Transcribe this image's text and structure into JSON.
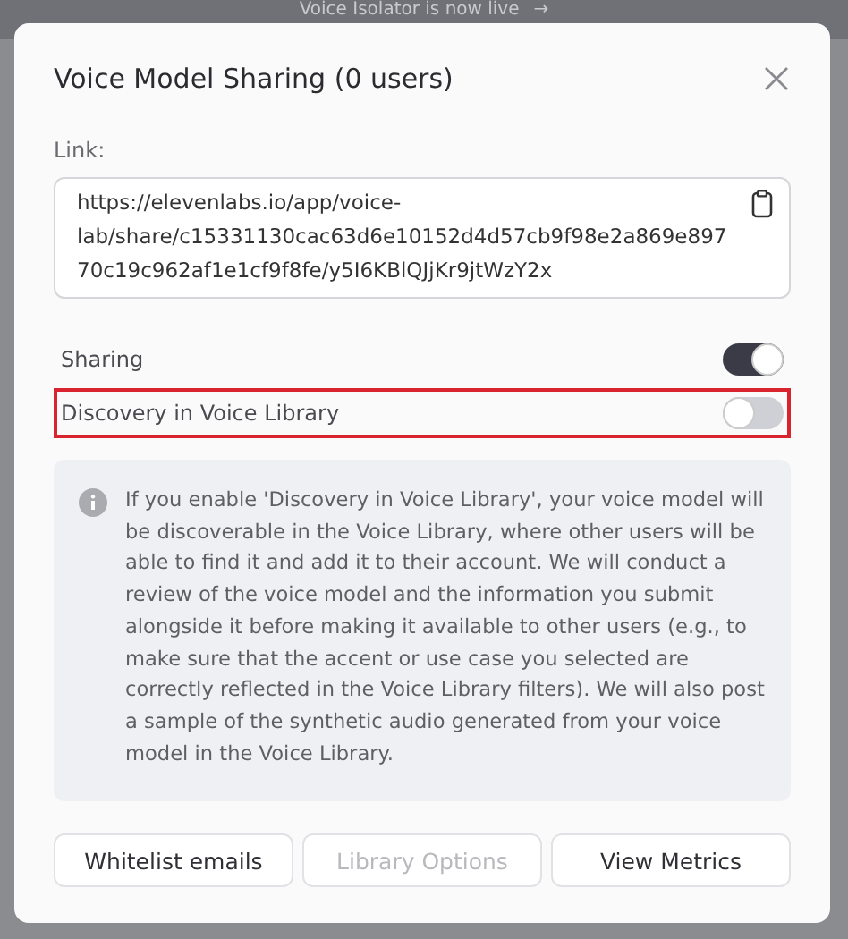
{
  "banner": {
    "text": "Voice Isolator is now live",
    "arrow": "→"
  },
  "dialog": {
    "title": "Voice Model Sharing (0 users)",
    "link": {
      "label": "Link:",
      "value": "https://elevenlabs.io/app/voice-lab/share/c15331130cac63d6e10152d4d57cb9f98e2a869e89770c19c962af1e1cf9f8fe/y5I6KBlQJjKr9jtWzY2x"
    },
    "toggles": [
      {
        "label": "Sharing",
        "on": true,
        "highlighted": false
      },
      {
        "label": "Discovery in Voice Library",
        "on": false,
        "highlighted": true
      }
    ],
    "info": "If you enable 'Discovery in Voice Library', your voice model will be discoverable in the Voice Library, where other users will be able to find it and add it to their account. We will conduct a review of the voice model and the information you submit alongside it before making it available to other users (e.g., to make sure that the accent or use case you selected are correctly reflected in the Voice Library filters). We will also post a sample of the synthetic audio generated from your voice model in the Voice Library.",
    "buttons": [
      {
        "label": "Whitelist emails",
        "disabled": false
      },
      {
        "label": "Library Options",
        "disabled": true
      },
      {
        "label": "View Metrics",
        "disabled": false
      }
    ]
  }
}
